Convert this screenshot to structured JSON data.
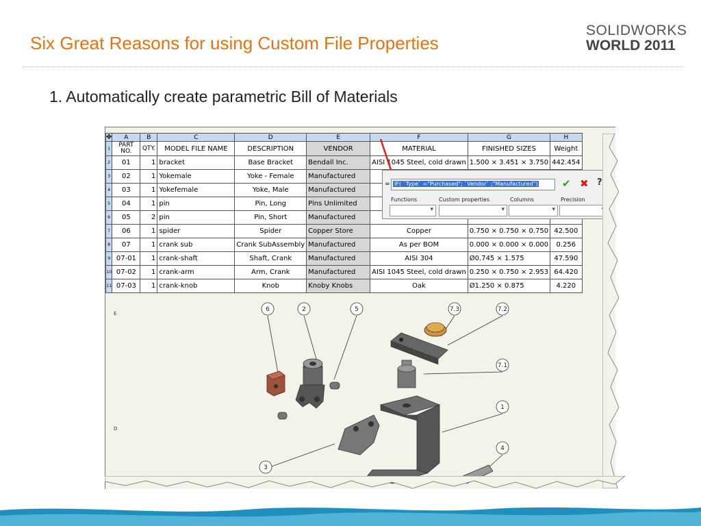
{
  "slide": {
    "title": "Six Great Reasons for using Custom File Properties",
    "logo_line1": "SOLIDWORKS",
    "logo_line2": "WORLD 2011",
    "bullet": "1.  Automatically create parametric Bill of Materials"
  },
  "bom": {
    "column_letters": [
      "A",
      "B",
      "C",
      "D",
      "E",
      "F",
      "G",
      "H"
    ],
    "headers": [
      "PART NO.",
      "QTY.",
      "MODEL FILE NAME",
      "DESCRIPTION",
      "VENDOR",
      "MATERIAL",
      "FINISHED SIZES",
      "Weight"
    ],
    "rows": [
      {
        "num": "2",
        "part": "01",
        "qty": "1",
        "model": "bracket",
        "desc": "Base Bracket",
        "vendor": "Bendall Inc.",
        "material": "AISI 1045 Steel, cold drawn",
        "size": "1.500 × 3.451 × 3.750",
        "weight": "442.454"
      },
      {
        "num": "3",
        "part": "02",
        "qty": "1",
        "model": "Yokemale",
        "desc": "Yoke - Female",
        "vendor": "Manufactured",
        "material": "",
        "size": "",
        "weight": ""
      },
      {
        "num": "4",
        "part": "03",
        "qty": "1",
        "model": "Yokefemale",
        "desc": "Yoke, Male",
        "vendor": "Manufactured",
        "material": "",
        "size": "",
        "weight": ""
      },
      {
        "num": "5",
        "part": "04",
        "qty": "1",
        "model": "pin",
        "desc": "Pin, Long",
        "vendor": "Pins Unlimited",
        "material": "",
        "size": "",
        "weight": ""
      },
      {
        "num": "6",
        "part": "05",
        "qty": "2",
        "model": "pin",
        "desc": "Pin, Short",
        "vendor": "Manufactured",
        "material": "",
        "size": "",
        "weight": ""
      },
      {
        "num": "7",
        "part": "06",
        "qty": "1",
        "model": "spider",
        "desc": "Spider",
        "vendor": "Copper Store",
        "material": "Copper",
        "size": "0.750 × 0.750 × 0.750",
        "weight": "42.500"
      },
      {
        "num": "8",
        "part": "07",
        "qty": "1",
        "model": "crank sub",
        "desc": "Crank SubAssembly",
        "vendor": "Manufactured",
        "material": "As per BOM",
        "size": "0.000 × 0.000 × 0.000",
        "weight": "0.256"
      },
      {
        "num": "9",
        "part": "07-01",
        "qty": "1",
        "model": "crank-shaft",
        "desc": "Shaft, Crank",
        "vendor": "Manufactured",
        "material": "AISI 304",
        "size": "Ø0.745 × 1.575",
        "weight": "47.590"
      },
      {
        "num": "10",
        "part": "07-02",
        "qty": "1",
        "model": "crank-arm",
        "desc": "Arm, Crank",
        "vendor": "Manufactured",
        "material": "AISI 1045 Steel, cold drawn",
        "size": "0.250 × 0.750 × 2.953",
        "weight": "64.420"
      },
      {
        "num": "11",
        "part": "07-03",
        "qty": "1",
        "model": "crank-knob",
        "desc": "Knob",
        "vendor": "Knoby Knobs",
        "material": "Oak",
        "size": "Ø1.250 × 0.875",
        "weight": "4.220"
      }
    ]
  },
  "formula_bar": {
    "eq": "=",
    "expression": "IF( `Type` =\"Purchased\"; `Vendor` ;\"Manufactured\")",
    "labels": {
      "functions": "Functions",
      "custom_properties": "Custom properties",
      "columns": "Columns",
      "precision": "Precision"
    },
    "icons": {
      "accept": "check-icon",
      "cancel": "x-icon",
      "help": "question-icon"
    },
    "colors": {
      "accept": "#2c9d2c",
      "cancel": "#d02020",
      "highlight": "#3a6fd0"
    }
  },
  "drawing": {
    "callouts": [
      "6",
      "2",
      "5",
      "7.3",
      "7.2",
      "7.1",
      "1",
      "4",
      "3"
    ],
    "margin_labels": [
      "E",
      "D"
    ]
  },
  "colors": {
    "title": "#e8730c",
    "header_blue": "#c5daf0",
    "vendor_column": "#d7d7d7",
    "arrow": "#e02020"
  }
}
